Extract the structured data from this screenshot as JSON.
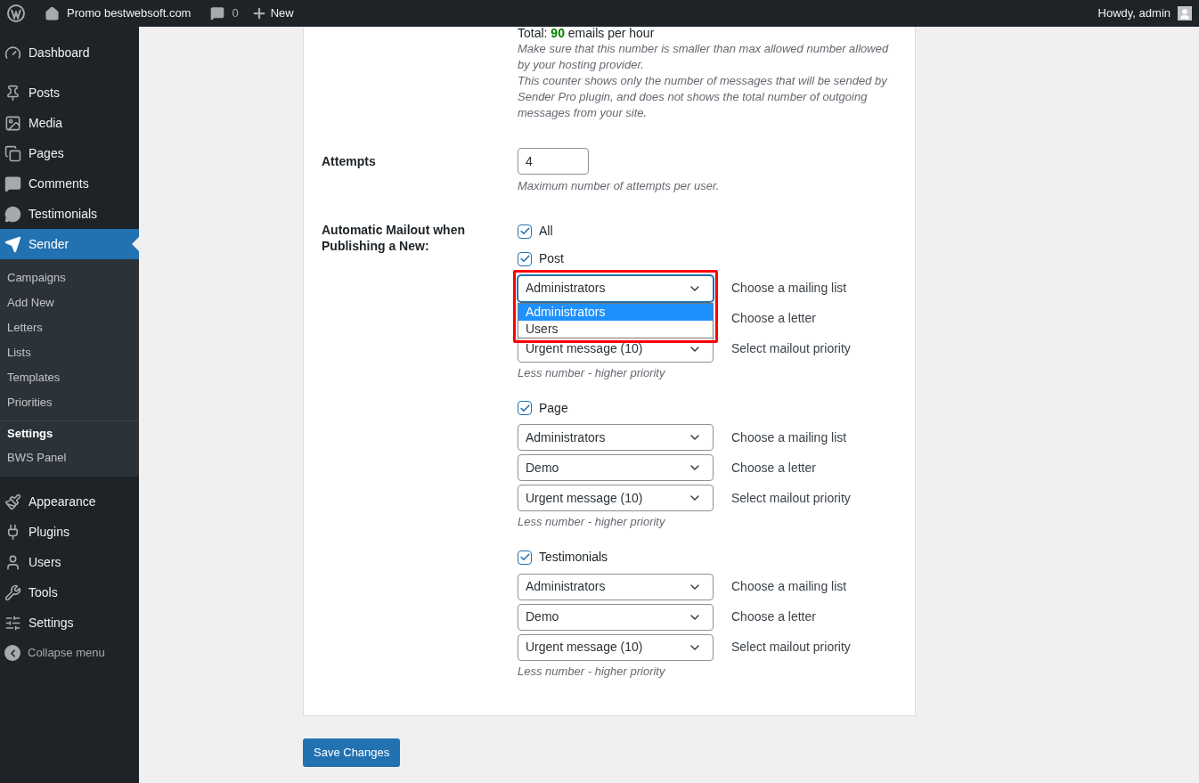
{
  "admin_bar": {
    "site_name": "Promo bestwebsoft.com",
    "comments_count": "0",
    "new_label": "New",
    "greeting": "Howdy, admin"
  },
  "sidebar": {
    "items": [
      {
        "label": "Dashboard",
        "selected": false
      },
      {
        "label": "Posts",
        "selected": false
      },
      {
        "label": "Media",
        "selected": false
      },
      {
        "label": "Pages",
        "selected": false
      },
      {
        "label": "Comments",
        "selected": false
      },
      {
        "label": "Testimonials",
        "selected": false
      },
      {
        "label": "Sender",
        "selected": true,
        "submenu": [
          {
            "label": "Campaigns",
            "selected": false
          },
          {
            "label": "Add New",
            "selected": false
          },
          {
            "label": "Letters",
            "selected": false
          },
          {
            "label": "Lists",
            "selected": false
          },
          {
            "label": "Templates",
            "selected": false
          },
          {
            "label": "Priorities",
            "selected": false
          },
          {
            "label": "Settings",
            "selected": true
          },
          {
            "label": "BWS Panel",
            "selected": false
          }
        ]
      },
      {
        "label": "Appearance",
        "selected": false
      },
      {
        "label": "Plugins",
        "selected": false
      },
      {
        "label": "Users",
        "selected": false
      },
      {
        "label": "Tools",
        "selected": false
      },
      {
        "label": "Settings",
        "selected": false
      }
    ],
    "collapse_label": "Collapse menu"
  },
  "total": {
    "label": "Total:",
    "value": "90",
    "suffix": "emails per hour",
    "notes": [
      "Make sure that this number is smaller than max allowed number allowed by your hosting provider.",
      "This counter shows only the number of messages that will be sended by Sender Pro plugin, and does not shows the total number of outgoing messages from your site."
    ]
  },
  "attempts": {
    "label": "Attempts",
    "value": "4",
    "hint": "Maximum number of attempts per user."
  },
  "mailout": {
    "label": "Automatic Mailout when Publishing a New:",
    "all": {
      "label": "All",
      "checked": true
    },
    "groups": [
      {
        "label": "Post",
        "checked": true,
        "selects": [
          {
            "value": "Administrators",
            "caption": "Choose a mailing list",
            "highlighted": true,
            "options": [
              {
                "label": "Administrators",
                "selected": true
              },
              {
                "label": "Users",
                "selected": false
              }
            ]
          },
          {
            "caption": "Choose a letter"
          },
          {
            "value": "Urgent message (10)",
            "caption": "Select mailout priority"
          }
        ],
        "hint": "Less number - higher priority"
      },
      {
        "label": "Page",
        "checked": true,
        "selects": [
          {
            "value": "Administrators",
            "caption": "Choose a mailing list"
          },
          {
            "value": "Demo",
            "caption": "Choose a letter"
          },
          {
            "value": "Urgent message (10)",
            "caption": "Select mailout priority"
          }
        ],
        "hint": "Less number - higher priority"
      },
      {
        "label": "Testimonials",
        "checked": true,
        "selects": [
          {
            "value": "Administrators",
            "caption": "Choose a mailing list"
          },
          {
            "value": "Demo",
            "caption": "Choose a letter"
          },
          {
            "value": "Urgent message (10)",
            "caption": "Select mailout priority"
          }
        ],
        "hint": "Less number - higher priority"
      }
    ]
  },
  "save_button": "Save Changes"
}
